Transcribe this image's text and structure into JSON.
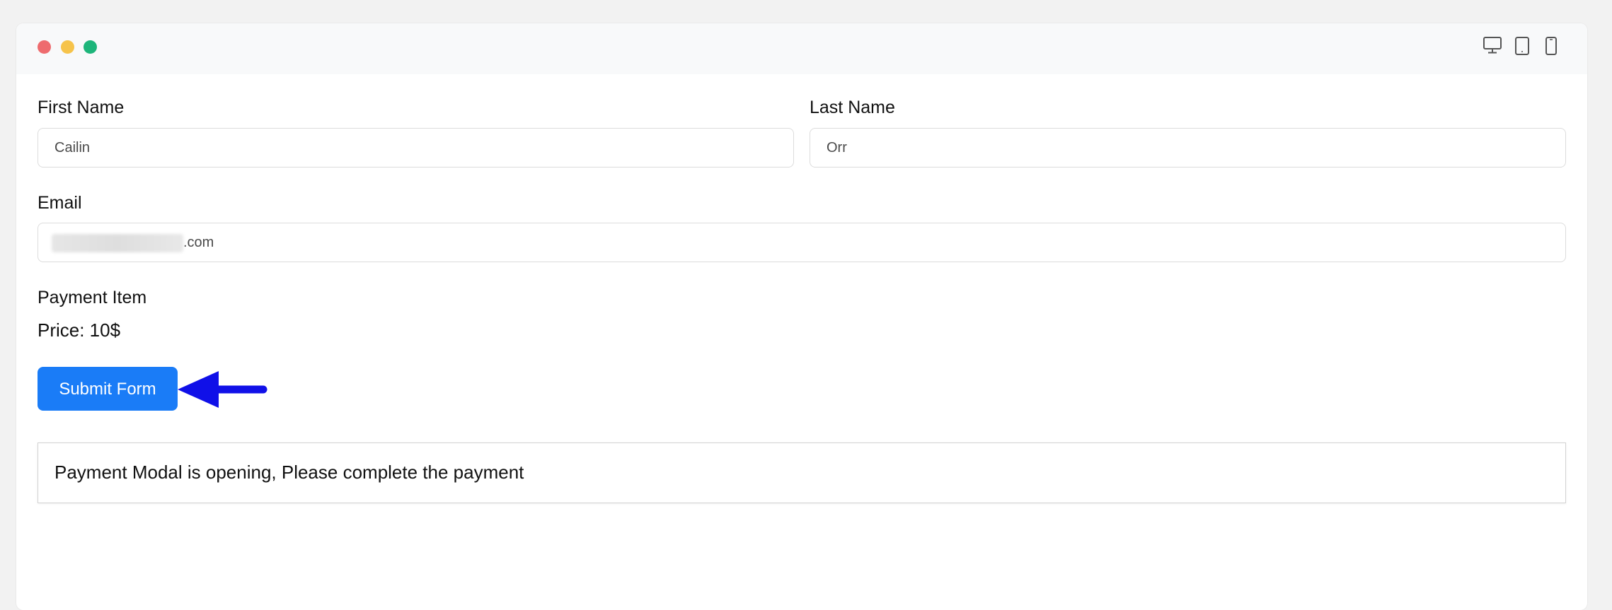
{
  "window": {
    "controls": [
      "close",
      "minimize",
      "maximize"
    ],
    "device_toggles": [
      "desktop-icon",
      "tablet-icon",
      "mobile-icon"
    ]
  },
  "form": {
    "first_name": {
      "label": "First Name",
      "value": "Cailin"
    },
    "last_name": {
      "label": "Last Name",
      "value": "Orr"
    },
    "email": {
      "label": "Email",
      "visible_value": ".com"
    },
    "payment_item": {
      "label": "Payment Item",
      "price": "Price: 10$"
    },
    "submit_label": "Submit Form"
  },
  "status": {
    "message": "Payment Modal is opening, Please complete the payment"
  },
  "colors": {
    "accent": "#1a7cf7",
    "annotation_arrow": "#1010e8",
    "close": "#ee6b6e",
    "minimize": "#f6c34a",
    "maximize": "#1db57a"
  }
}
